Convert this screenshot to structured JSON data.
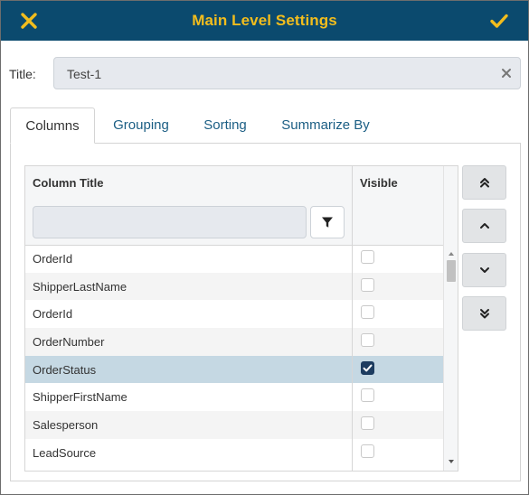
{
  "header": {
    "title": "Main Level Settings",
    "close_icon": "close-icon",
    "confirm_icon": "checkmark-icon",
    "background_color": "#0b4a6e",
    "accent_color": "#f2bd1d"
  },
  "title_field": {
    "label": "Title:",
    "value": "Test-1",
    "clear_icon": "clear-x-icon"
  },
  "tabs": [
    {
      "label": "Columns",
      "active": true
    },
    {
      "label": "Grouping",
      "active": false
    },
    {
      "label": "Sorting",
      "active": false
    },
    {
      "label": "Summarize By",
      "active": false
    }
  ],
  "grid": {
    "columns": [
      "Column Title",
      "Visible"
    ],
    "filter": {
      "value": "",
      "button_icon": "filter-funnel-icon"
    },
    "rows": [
      {
        "title": "OrderId",
        "visible": false,
        "selected": false
      },
      {
        "title": "ShipperLastName",
        "visible": false,
        "selected": false
      },
      {
        "title": "OrderId",
        "visible": false,
        "selected": false
      },
      {
        "title": "OrderNumber",
        "visible": false,
        "selected": false
      },
      {
        "title": "OrderStatus",
        "visible": true,
        "selected": true
      },
      {
        "title": "ShipperFirstName",
        "visible": false,
        "selected": false
      },
      {
        "title": "Salesperson",
        "visible": false,
        "selected": false
      },
      {
        "title": "LeadSource",
        "visible": false,
        "selected": false
      }
    ],
    "selected_row_color": "#c5d8e3"
  },
  "move_buttons": [
    {
      "name": "move-to-top-button",
      "icon": "double-chevron-up-icon"
    },
    {
      "name": "move-up-button",
      "icon": "chevron-up-icon"
    },
    {
      "name": "move-down-button",
      "icon": "chevron-down-icon"
    },
    {
      "name": "move-to-bottom-button",
      "icon": "double-chevron-down-icon"
    }
  ]
}
